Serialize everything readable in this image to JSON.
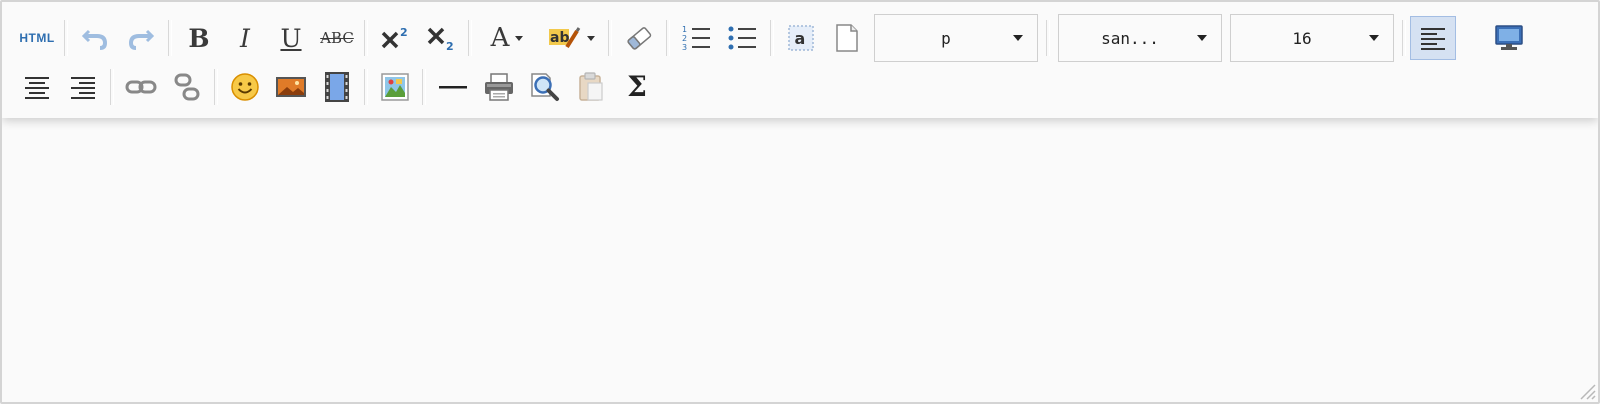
{
  "toolbar": {
    "source_label": "HTML",
    "format_select": {
      "value": "p"
    },
    "font_family_select": {
      "value": "san..."
    },
    "font_size_select": {
      "value": "16"
    },
    "sigma_symbol": "Σ"
  },
  "icons": [
    "html-source-icon",
    "undo-icon",
    "redo-icon",
    "bold-icon",
    "italic-icon",
    "underline-icon",
    "strikethrough-icon",
    "superscript-icon",
    "subscript-icon",
    "font-color-icon",
    "highlight-color-icon",
    "eraser-icon",
    "ordered-list-icon",
    "unordered-list-icon",
    "select-all-icon",
    "blank-page-icon",
    "align-left-icon",
    "fullscreen-icon",
    "align-center-icon",
    "align-right-icon",
    "link-icon",
    "unlink-icon",
    "emoticon-icon",
    "image-icon",
    "video-icon",
    "map-image-icon",
    "horizontal-rule-icon",
    "print-icon",
    "preview-icon",
    "paste-icon",
    "formula-icon"
  ],
  "colors": {
    "accent": "#2e6eb0",
    "active_bg": "#d5e1f2",
    "border": "#d4d4d4",
    "background": "#fafafa"
  }
}
